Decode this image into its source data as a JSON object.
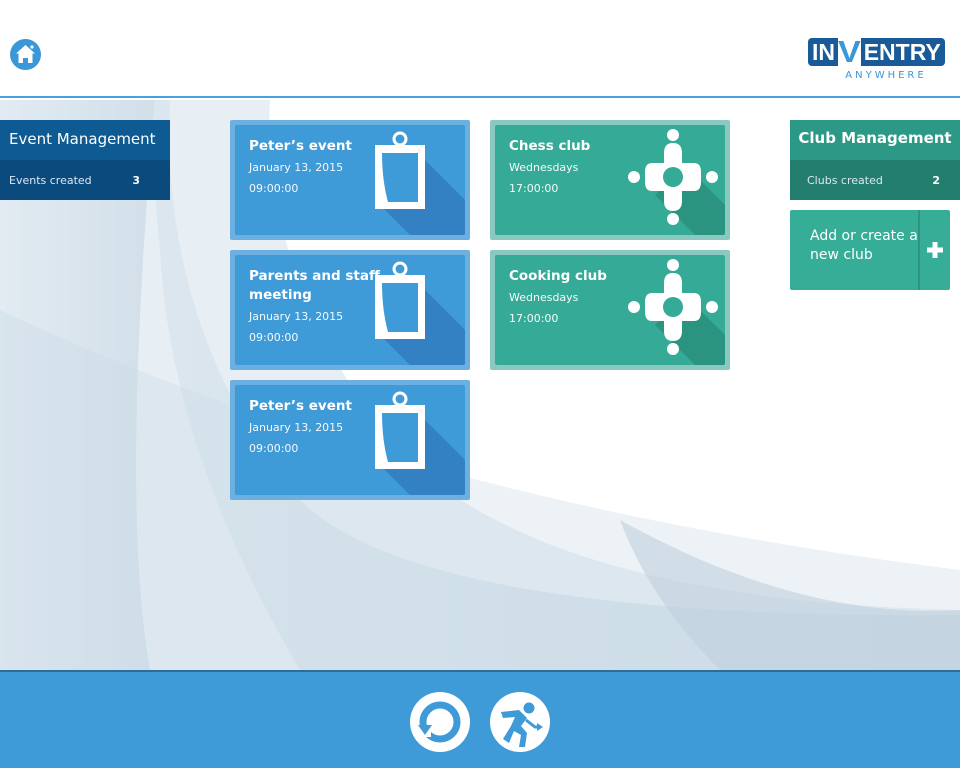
{
  "header": {
    "home_icon": "home-icon",
    "logo": {
      "in": "IN",
      "v": "V",
      "entry": "ENTRY",
      "sub": "ANYWHERE"
    }
  },
  "event_panel": {
    "title": "Event Management",
    "stat_label": "Events created",
    "stat_value": "3"
  },
  "club_panel": {
    "title": "Club Management",
    "stat_label": "Clubs created",
    "stat_value": "2"
  },
  "add_club": {
    "label": "Add or create a new club",
    "icon": "plus-icon"
  },
  "events": [
    {
      "title": "Peter’s event",
      "date": "January 13, 2015",
      "time": "09:00:00",
      "icon": "clipboard-icon"
    },
    {
      "title": "Parents and staff meeting",
      "date": "January 13, 2015",
      "time": "09:00:00",
      "icon": "clipboard-icon"
    },
    {
      "title": "Peter’s event",
      "date": "January 13, 2015",
      "time": "09:00:00",
      "icon": "clipboard-icon"
    }
  ],
  "clubs": [
    {
      "title": "Chess club",
      "day": "Wednesdays",
      "time": "17:00:00",
      "icon": "people-around-table-icon"
    },
    {
      "title": "Cooking club",
      "day": "Wednesdays",
      "time": "17:00:00",
      "icon": "people-around-table-icon"
    }
  ],
  "footer": {
    "buttons": [
      "refresh-icon",
      "exit-icon"
    ]
  },
  "colors": {
    "event_blue": "#3f9ad8",
    "event_dark": "#0e5a92",
    "club_green": "#35ab97",
    "club_dark": "#2b9985"
  }
}
